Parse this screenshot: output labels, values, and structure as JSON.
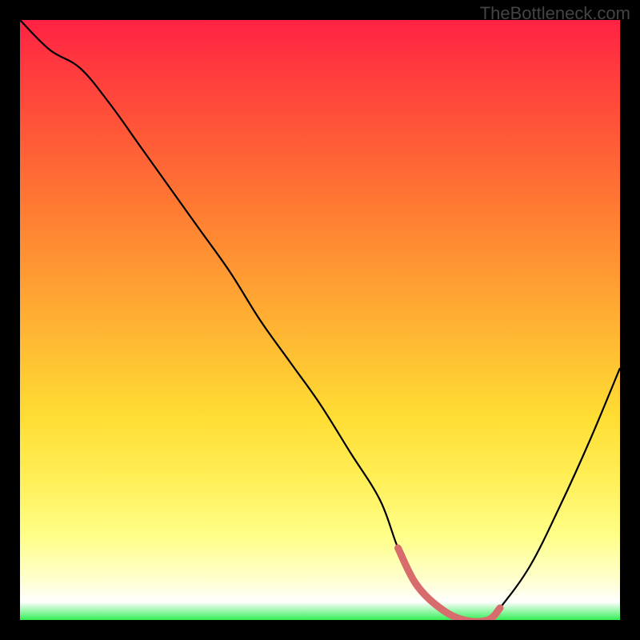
{
  "watermark": "TheBottleneck.com",
  "chart_data": {
    "type": "line",
    "title": "",
    "xlabel": "",
    "ylabel": "",
    "xlim": [
      0,
      100
    ],
    "ylim": [
      0,
      100
    ],
    "series": [
      {
        "name": "bottleneck-curve",
        "x": [
          0,
          5,
          10,
          15,
          20,
          25,
          30,
          35,
          40,
          45,
          50,
          55,
          60,
          63,
          66,
          70,
          74,
          78,
          80,
          85,
          90,
          95,
          100
        ],
        "values": [
          100,
          95,
          92,
          86,
          79,
          72,
          65,
          58,
          50,
          43,
          36,
          28,
          20,
          12,
          6,
          2,
          0,
          0,
          2,
          9,
          19,
          30,
          42
        ]
      }
    ],
    "highlight_segment": {
      "name": "optimal-range",
      "x": [
        63,
        66,
        70,
        74,
        78,
        80
      ],
      "values": [
        12,
        6,
        2,
        0,
        0,
        2
      ],
      "color": "#d86b6b"
    }
  },
  "colors": {
    "curve": "#000000",
    "highlight": "#d86b6b",
    "background_frame": "#000000"
  }
}
